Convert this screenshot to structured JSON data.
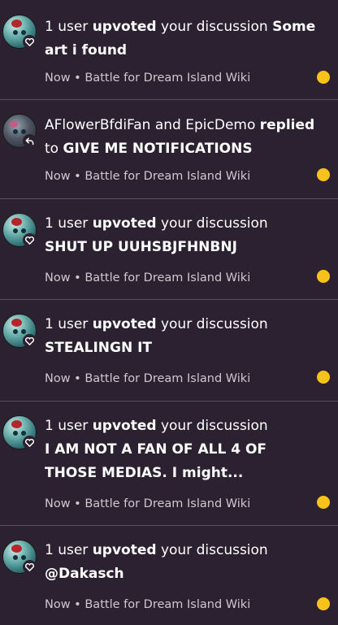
{
  "colors": {
    "background": "#2c2130",
    "divider": "#5b4f5e",
    "unread_dot": "#f6c21b",
    "meta_text": "#cfc8d0"
  },
  "notifications": [
    {
      "avatar": "teal-character-avatar",
      "badge_icon": "heart-icon",
      "prefix": "1 user ",
      "action": "upvoted",
      "middle": " your discussion ",
      "target": "Some art i found",
      "time": "Now",
      "separator": " • ",
      "community": "Battle for Dream Island Wiki",
      "unread": true
    },
    {
      "avatar": "grey-character-avatar",
      "badge_icon": "reply-arrow-icon",
      "prefix": "AFlowerBfdiFan and EpicDemo ",
      "action": "replied",
      "middle": " to ",
      "target": "GIVE ME NOTIFICATIONS",
      "time": "Now",
      "separator": " • ",
      "community": "Battle for Dream Island Wiki",
      "unread": true
    },
    {
      "avatar": "teal-character-avatar",
      "badge_icon": "heart-icon",
      "prefix": "1 user ",
      "action": "upvoted",
      "middle": " your discussion",
      "target": "SHUT UP UUHSBJFHNBNJ",
      "time": "Now",
      "separator": " • ",
      "community": "Battle for Dream Island Wiki",
      "unread": true
    },
    {
      "avatar": "teal-character-avatar",
      "badge_icon": "heart-icon",
      "prefix": "1 user ",
      "action": "upvoted",
      "middle": " your discussion",
      "target": "STEALINGN IT",
      "time": "Now",
      "separator": " • ",
      "community": "Battle for Dream Island Wiki",
      "unread": true
    },
    {
      "avatar": "teal-character-avatar",
      "badge_icon": "heart-icon",
      "prefix": "1 user ",
      "action": "upvoted",
      "middle": " your discussion",
      "target": "I AM NOT A FAN OF ALL 4 OF THOSE MEDIAS. I might...",
      "time": "Now",
      "separator": " • ",
      "community": "Battle for Dream Island Wiki",
      "unread": true
    },
    {
      "avatar": "teal-character-avatar",
      "badge_icon": "heart-icon",
      "prefix": "1 user ",
      "action": "upvoted",
      "middle": " your discussion",
      "target": "@Dakasch",
      "time": "Now",
      "separator": " • ",
      "community": "Battle for Dream Island Wiki",
      "unread": true
    }
  ]
}
